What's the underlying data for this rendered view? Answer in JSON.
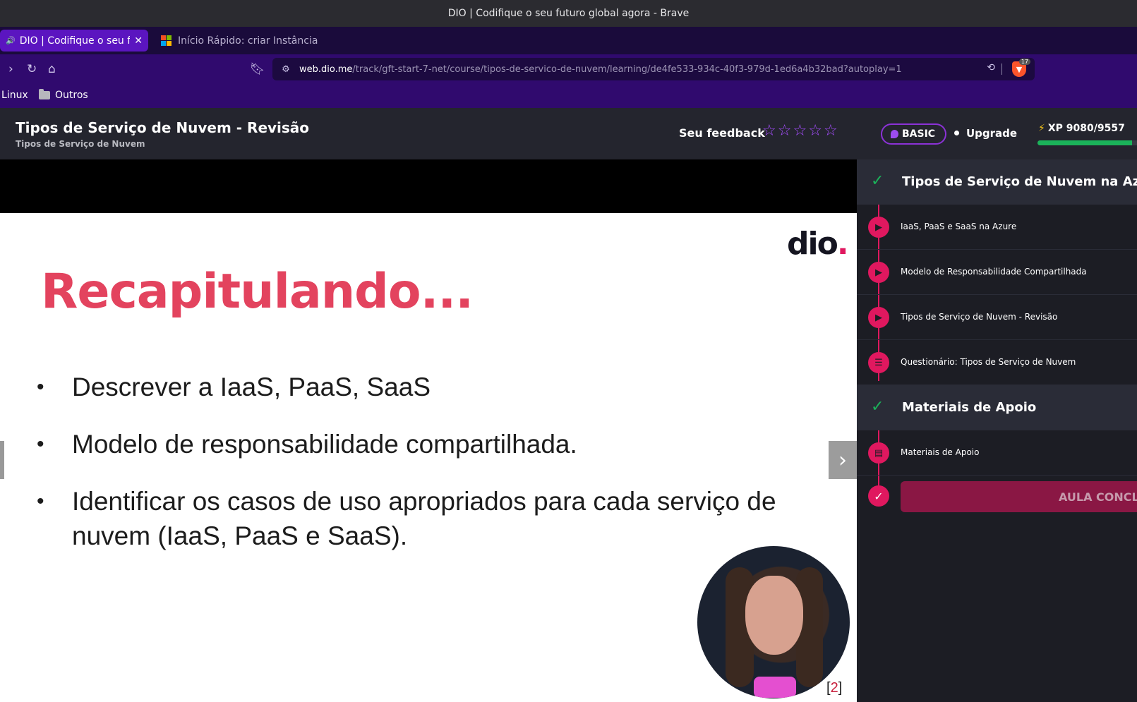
{
  "window": {
    "title": "DIO | Codifique o seu futuro global agora - Brave"
  },
  "tabs": [
    {
      "label": "DIO | Codifique o seu futuro global agora",
      "active": true
    },
    {
      "label": "Início Rápido: criar Instância C",
      "active": false
    }
  ],
  "toolbar": {
    "url_host": "web.dio.me",
    "url_path": "/track/gft-start-7-net/course/tipos-de-servico-de-nuvem/learning/de4fe533-934c-40f3-979d-1ed6a4b32bad?autoplay=1",
    "brave_badge": "17"
  },
  "bookmarks": [
    {
      "label": "Linux"
    },
    {
      "label": "Outros"
    }
  ],
  "lesson": {
    "title": "Tipos de Serviço de Nuvem - Revisão",
    "subtitle": "Tipos de Serviço de Nuvem",
    "feedback_label": "Seu feedback",
    "stars": [
      "☆",
      "☆",
      "☆",
      "☆",
      "☆"
    ]
  },
  "account": {
    "plan": "BASIC",
    "upgrade": "Upgrade",
    "xp_text": "XP 9080/9557",
    "xp_fraction": 0.95
  },
  "slide": {
    "logo": "dio",
    "logo_dot": ".",
    "heading": "Recapitulando...",
    "bullets": [
      "Descrever a IaaS, PaaS, SaaS",
      "Modelo de responsabilidade compartilhada.",
      "Identificar os casos de uso apropriados para cada serviço de nuvem (IaaS, PaaS e SaaS)."
    ],
    "page_open": "[",
    "page_number": "2",
    "page_close": "]"
  },
  "sidebar": {
    "sections": [
      {
        "title": "Tipos de Serviço de Nuvem na Azure",
        "items": [
          {
            "label": "IaaS, PaaS e SaaS na Azure",
            "icon": "play-icon"
          },
          {
            "label": "Modelo de Responsabilidade Compartilhada",
            "icon": "play-icon"
          },
          {
            "label": "Tipos de Serviço de Nuvem - Revisão",
            "icon": "play-icon"
          },
          {
            "label": "Questionário: Tipos de Serviço de Nuvem",
            "icon": "list-icon"
          }
        ]
      },
      {
        "title": "Materiais de Apoio",
        "items": [
          {
            "label": "Materiais de Apoio",
            "icon": "document-icon"
          }
        ]
      }
    ],
    "complete_button": "AULA CONCLU"
  },
  "colors": {
    "accent": "#e0185f",
    "purple": "#8b32d6",
    "success": "#1bb35a",
    "heading": "#e3435e"
  }
}
